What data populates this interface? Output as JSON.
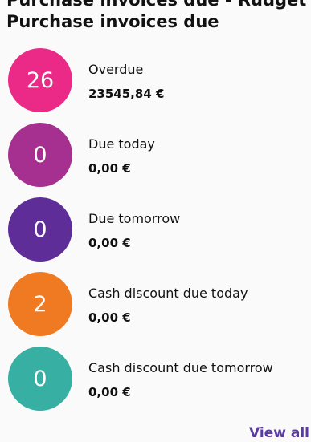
{
  "header": {
    "cut_title": "Purchase invoices due - Rudget",
    "title": "Purchase invoices due"
  },
  "items": [
    {
      "count": "26",
      "label": "Overdue",
      "amount": "23545,84 €",
      "color": "#ea2a86"
    },
    {
      "count": "0",
      "label": "Due today",
      "amount": "0,00 €",
      "color": "#a5308f"
    },
    {
      "count": "0",
      "label": "Due tomorrow",
      "amount": "0,00 €",
      "color": "#5e2d98"
    },
    {
      "count": "2",
      "label": "Cash discount due today",
      "amount": "0,00 €",
      "color": "#f07a22"
    },
    {
      "count": "0",
      "label": "Cash discount due tomorrow",
      "amount": "0,00 €",
      "color": "#37afa2"
    }
  ],
  "footer": {
    "view_all_label": "View all",
    "link_color": "#5a3aa0"
  }
}
